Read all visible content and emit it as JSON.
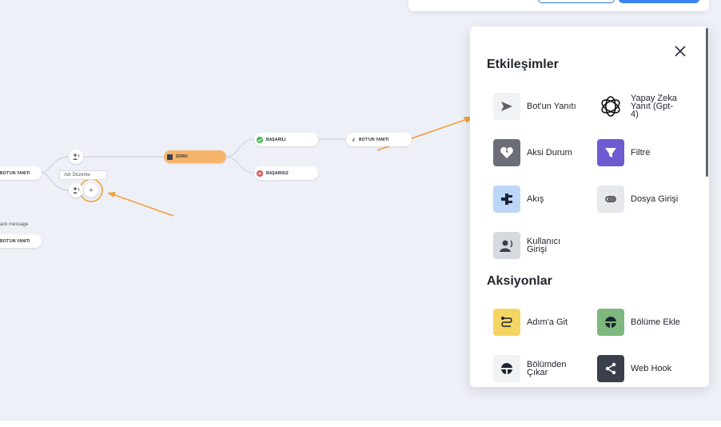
{
  "canvas": {
    "nodes": {
      "left_bot_reply": "BOT'UN YANITI",
      "left_bot_reply_2": "BOT'UN YANITI",
      "rename_tag": "Adı Düzenle",
      "fallback_message": "ack message",
      "question": "SORU",
      "success": "BAŞARILI",
      "failure": "BAŞARISIZ",
      "bot_reply": "BOT'UN YANITI"
    },
    "add_button_label": "+"
  },
  "panel": {
    "close_glyph": "✕",
    "sections": [
      {
        "title": "Etkileşimler",
        "items": [
          {
            "label": "Bot'un Yanıtı",
            "icon": "send-icon",
            "color": "#f1f2f4"
          },
          {
            "label": "Yapay Zeka\nYanıt (Gpt-\n4)",
            "icon": "openai-icon",
            "color": "#ffffff"
          },
          {
            "label": "Aksi Durum",
            "icon": "broken-heart-icon",
            "color": "#6b6e78"
          },
          {
            "label": "Filtre",
            "icon": "filter-icon",
            "color": "#6d5bd0"
          },
          {
            "label": "Akış",
            "icon": "flow-icon",
            "color": "#bcd6f7"
          },
          {
            "label": "Dosya Girişi",
            "icon": "paperclip-icon",
            "color": "#e7e8eb"
          },
          {
            "label": "Kullanıcı\nGirişi",
            "icon": "user-voice-icon",
            "color": "#d6d9e0"
          }
        ]
      },
      {
        "title": "Aksiyonlar",
        "items": [
          {
            "label": "Adım'a Git",
            "icon": "goto-step-icon",
            "color": "#f5d561"
          },
          {
            "label": "Bölüme Ekle",
            "icon": "add-to-segment-icon",
            "color": "#7fb87e"
          },
          {
            "label": "Bölümden\nÇıkar",
            "icon": "remove-from-segment-icon",
            "color": "#f1f2f4"
          },
          {
            "label": "Web Hook",
            "icon": "share-icon",
            "color": "#3a3f4c"
          }
        ]
      }
    ]
  },
  "colors": {
    "canvas_bg": "#edf0f7",
    "annotation_orange": "#f0a03c",
    "question_node": "#f5b46a",
    "success_green": "#3fb950",
    "failure_red": "#e5484d"
  }
}
